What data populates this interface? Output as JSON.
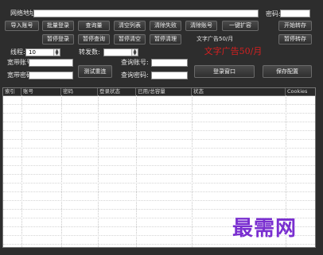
{
  "form": {
    "url_label": "网络地址:",
    "url_value": "",
    "password_label": "密码:",
    "password_value": "",
    "thread_label": "线程:",
    "thread_value": "10",
    "fav_label": "转发数:",
    "fav_value": "",
    "account_label": "宽带账号:",
    "account_value": "",
    "account_pwd_label": "宽带密码:",
    "account_pwd_value": "",
    "card_label": "查询账号:",
    "card_value": "",
    "card_pwd_label": "查询密码:",
    "card_pwd_value": "",
    "ad_note": "文字广告50/月",
    "ad_red": "文字广告50/月"
  },
  "buttons": {
    "import_accounts": "导入账号",
    "batch_login": "批量登录",
    "check_qty": "查询量",
    "clear_list": "清空列表",
    "clear_fail": "清除失败",
    "remove_account": "清除账号",
    "one_click": "一键扩容",
    "start_forward": "开始转存",
    "pause_login": "暂停登录",
    "pause_check": "暂停查询",
    "pause_clear": "暂停清空",
    "pause_cleanup": "暂停清理",
    "pause_forward": "暂停转存",
    "test_reconnect": "测试重连",
    "login_window": "登录窗口",
    "save_config": "保存配置"
  },
  "table": {
    "columns": [
      "索引",
      "账号",
      "密码",
      "登录状态",
      "已用/总容量",
      "状态",
      "Cookies"
    ]
  },
  "watermark": "最需网"
}
